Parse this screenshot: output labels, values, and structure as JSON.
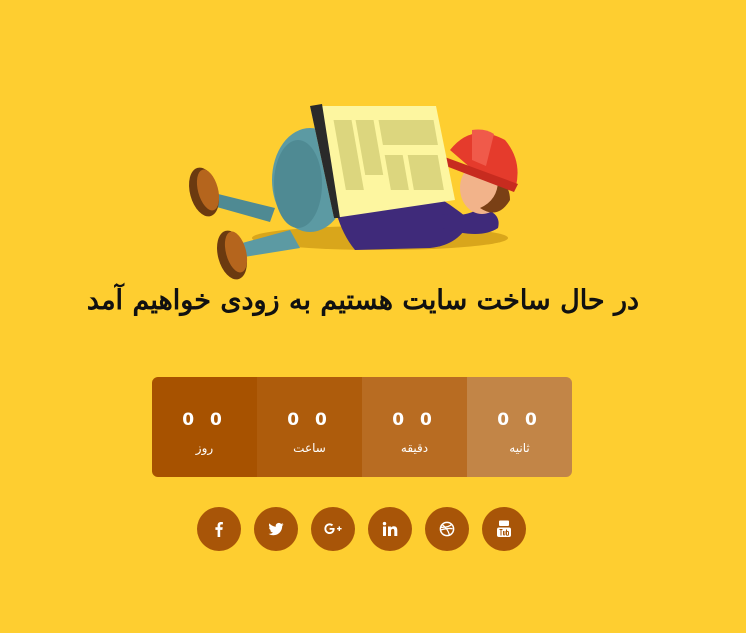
{
  "headline": "در حال ساخت سایت هستیم به زودی خواهیم آمد",
  "countdown": [
    {
      "label": "روز",
      "value": "0 0",
      "color": "#a75200"
    },
    {
      "label": "ساعت",
      "value": "0 0",
      "color": "#ae5c0c"
    },
    {
      "label": "دقیقه",
      "value": "0 0",
      "color": "#b86c22"
    },
    {
      "label": "ثانیه",
      "value": "0 0",
      "color": "#c28547"
    }
  ],
  "social": [
    {
      "name": "facebook-icon"
    },
    {
      "name": "twitter-icon"
    },
    {
      "name": "google-plus-icon"
    },
    {
      "name": "linkedin-icon"
    },
    {
      "name": "dribbble-icon"
    },
    {
      "name": "youtube-icon"
    }
  ],
  "colors": {
    "background": "#fece30",
    "social_button": "#a85508"
  }
}
